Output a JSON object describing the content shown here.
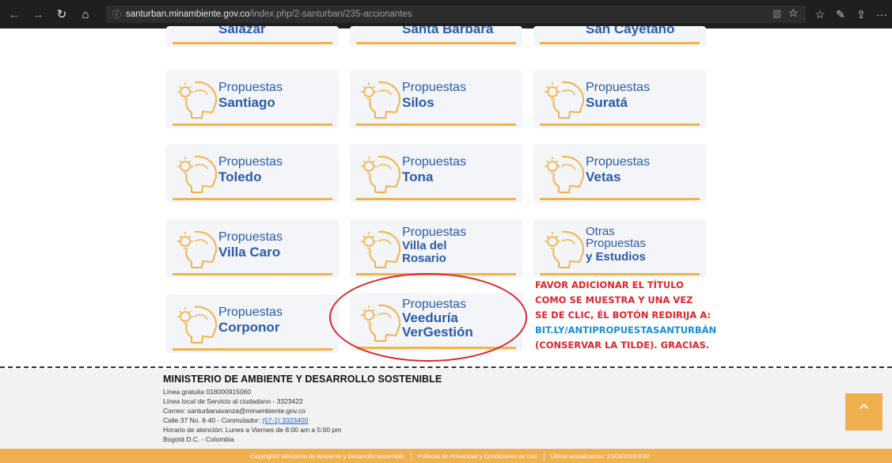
{
  "browser": {
    "url_host": "santurban.minambiente.gov.co",
    "url_path": "/index.php/2-santurban/235-accionantes"
  },
  "cards": [
    {
      "line1": "",
      "line2": "Salazar"
    },
    {
      "line1": "",
      "line2": "Santa Bárbara"
    },
    {
      "line1": "",
      "line2": "San Cayetano"
    },
    {
      "line1": "Propuestas",
      "line2": "Santiago"
    },
    {
      "line1": "Propuestas",
      "line2": "Silos"
    },
    {
      "line1": "Propuestas",
      "line2": "Suratá"
    },
    {
      "line1": "Propuestas",
      "line2": "Toledo"
    },
    {
      "line1": "Propuestas",
      "line2": "Tona"
    },
    {
      "line1": "Propuestas",
      "line2": "Vetas"
    },
    {
      "line1": "Propuestas",
      "line2": "Villa Caro"
    },
    {
      "line1": "Propuestas",
      "line2": "Villa del",
      "line3": "Rosario"
    },
    {
      "line1": "Otras",
      "line2": "Propuestas",
      "line3": "y Estudios"
    },
    {
      "line1": "Propuestas",
      "line2": "Corponor"
    },
    {
      "line1": "Propuestas",
      "line2": "Veeduría",
      "line3": "VerGestión"
    }
  ],
  "annotation": {
    "l1": "FAVOR ADICIONAR EL TÍTULO",
    "l2": "COMO SE MUESTRA Y UNA VEZ",
    "l3": "SE DE CLIC, ÉL BOTÓN REDIRIJA A:",
    "l4": "BIT.LY/ANTIPROPUESTASANTURBÁN",
    "l5": "(CONSERVAR LA TILDE). GRACIAS."
  },
  "footer": {
    "org": "MINISTERIO DE AMBIENTE Y DESARROLLO SOSTENIBLE",
    "l1": "Línea gratuita 018000915060",
    "l2": "Línea local de Servicio al ciudadano - 3323422",
    "l3": "Correo: santurbanavanza@minambiente.gov.co",
    "l4a": "Calle 37 No. 8-40 - Conmutador: ",
    "l4b": "(57-1) 3323400",
    "l5": "Horario de atención: Lunes a Viernes de 8:00 am a 5:00 pm",
    "l6": "Bogotá D.C. - Colombia"
  },
  "bottom": {
    "copyright": "Copyright© Ministerio de Ambiente y Desarrollo Sostenible",
    "privacy": "Políticas de Privacidad y Condiciones de Uso",
    "updated": "Última actualización: 21/03/2019 8:00"
  },
  "icons": {
    "back": "←",
    "forward": "→",
    "refresh": "↻",
    "home": "⌂",
    "info": "ⓘ",
    "reading": "▥",
    "favorite": "☆",
    "favorites_bar": "☆",
    "pen": "✎",
    "share": "⇪",
    "more": "···",
    "to_top": "⌃"
  }
}
